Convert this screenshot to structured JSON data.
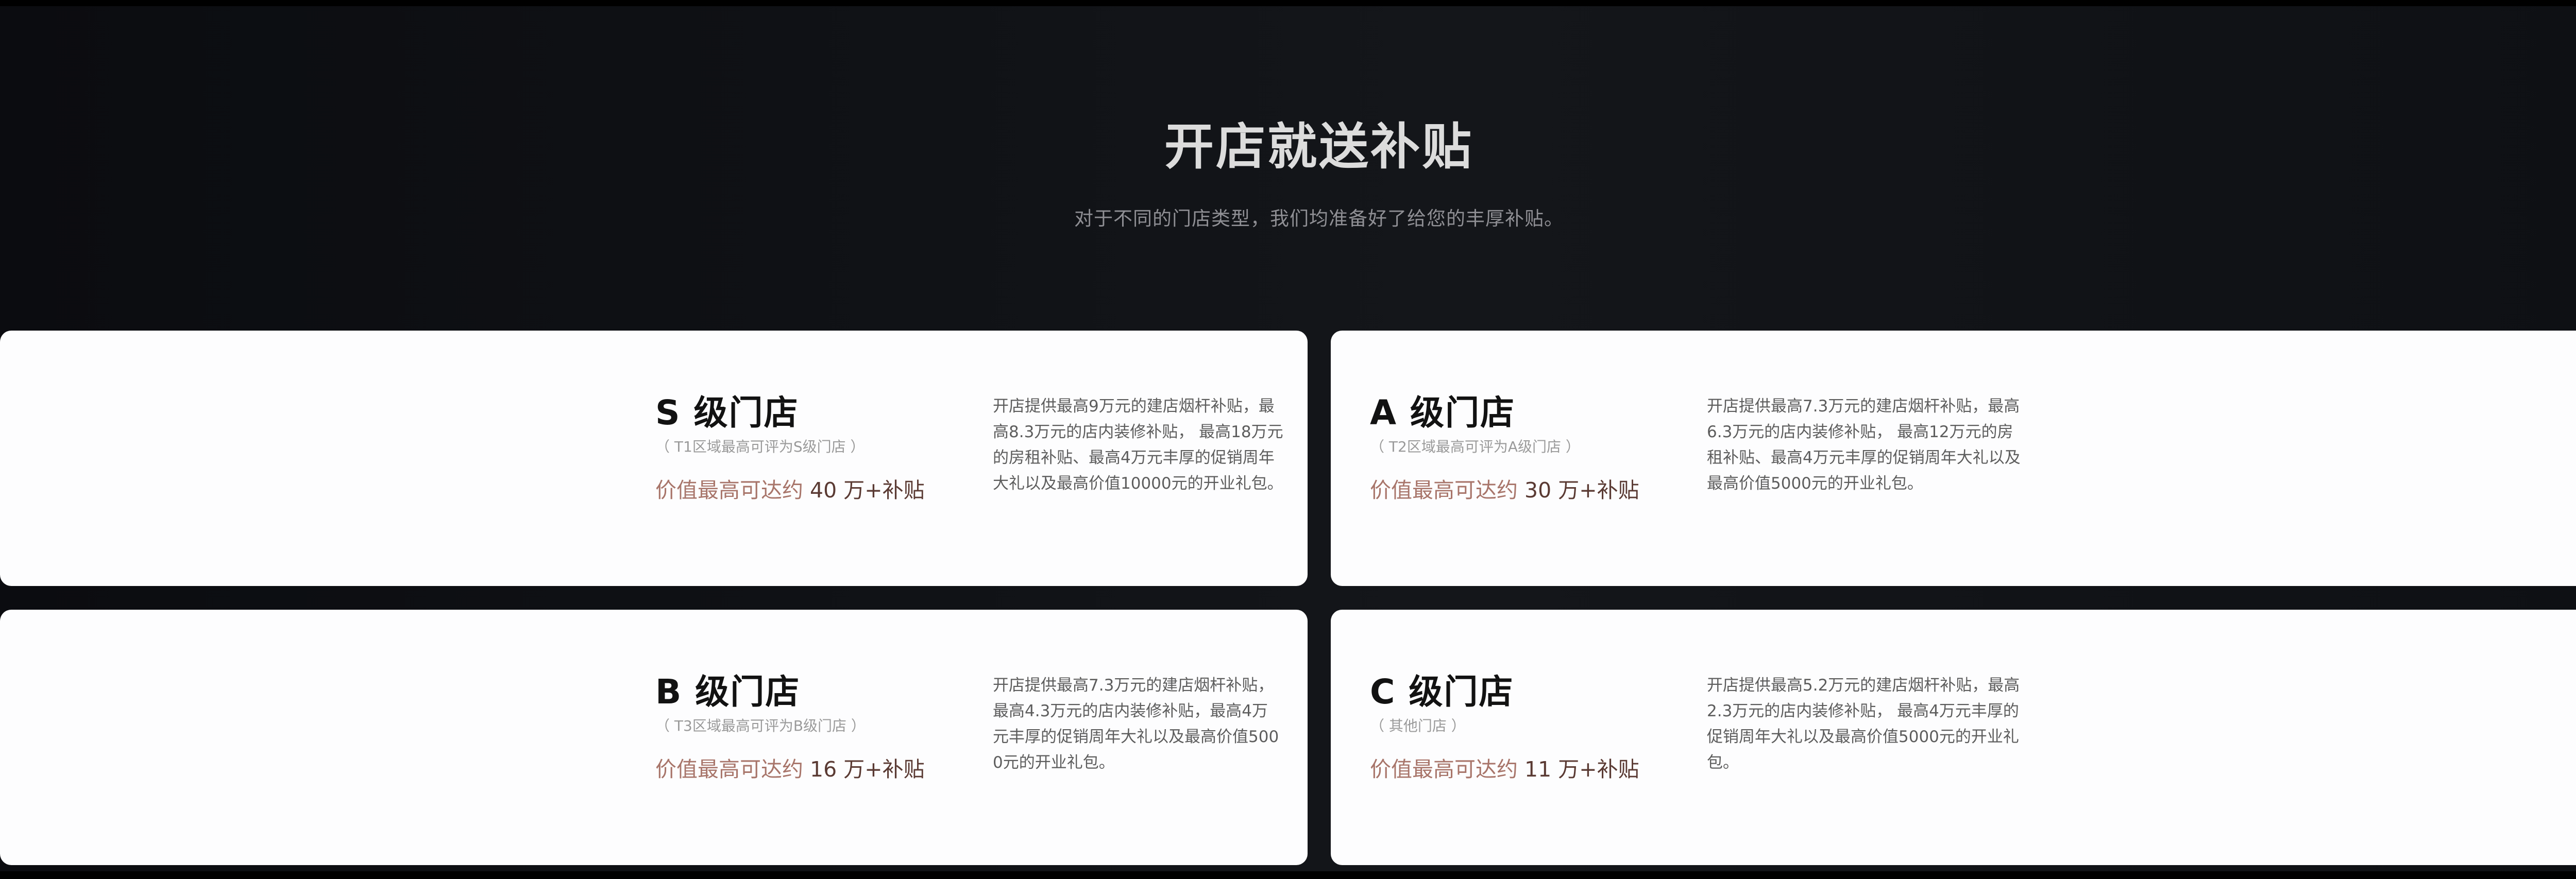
{
  "hero": {
    "title": "开店就送补贴",
    "subtitle": "对于不同的门店类型，我们均准备好了给您的丰厚补贴。"
  },
  "cards": [
    {
      "title": "S 级门店",
      "note": "（ T1区域最高可评为S级门店 ）",
      "value_prefix": "价值最高可达约",
      "value_amount": " 40 万+补贴",
      "description": "开店提供最高9万元的建店烟杆补贴，最高8.3万元的店内装修补贴， 最高18万元的房租补贴、最高4万元丰厚的促销周年大礼以及最高价值10000元的开业礼包。"
    },
    {
      "title": "A 级门店",
      "note": "（ T2区域最高可评为A级门店 ）",
      "value_prefix": "价值最高可达约",
      "value_amount": " 30 万+补贴",
      "description": "开店提供最高7.3万元的建店烟杆补贴，最高6.3万元的店内装修补贴， 最高12万元的房租补贴、最高4万元丰厚的促销周年大礼以及最高价值5000元的开业礼包。"
    },
    {
      "title": "B 级门店",
      "note": "（ T3区域最高可评为B级门店 ）",
      "value_prefix": "价值最高可达约",
      "value_amount": " 16 万+补贴",
      "description": "开店提供最高7.3万元的建店烟杆补贴， 最高4.3万元的店内装修补贴，最高4万元丰厚的促销周年大礼以及最高价值5000元的开业礼包。"
    },
    {
      "title": "C 级门店",
      "note": "（ 其他门店 ）",
      "value_prefix": "价值最高可达约",
      "value_amount": " 11 万+补贴",
      "description": "开店提供最高5.2万元的建店烟杆补贴，最高2.3万元的店内装修补贴， 最高4万元丰厚的促销周年大礼以及最高价值5000元的开业礼包。"
    }
  ],
  "colors": {
    "background": "#000000",
    "card_background": "#fdfdfe",
    "accent_value": "#a8756a",
    "accent_value_dark": "#5a3a33"
  }
}
